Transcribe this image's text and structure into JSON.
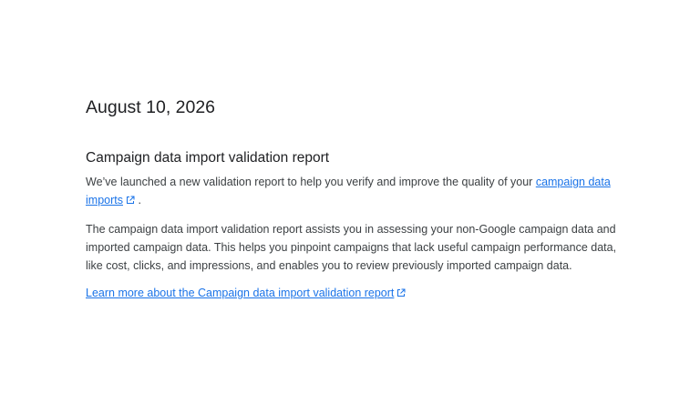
{
  "date": "August 10, 2026",
  "section": {
    "title": "Campaign data import validation report",
    "intro_prefix": "We’ve launched a new validation report to help you verify and improve the quality of your ",
    "intro_link": "campaign data imports",
    "intro_suffix": " .",
    "body": "The campaign data import validation report assists you in assessing your non-Google campaign data and imported campaign data. This helps you pinpoint campaigns that lack useful campaign performance data, like cost, clicks, and impressions, and enables you to review previously imported campaign data.",
    "learn_more_link": "Learn more about the Campaign data import validation report"
  },
  "icons": {
    "external_link": "external-link-icon"
  },
  "colors": {
    "link": "#1a73e8",
    "text": "#202124",
    "body_text": "#3c4043",
    "background": "#ffffff"
  }
}
